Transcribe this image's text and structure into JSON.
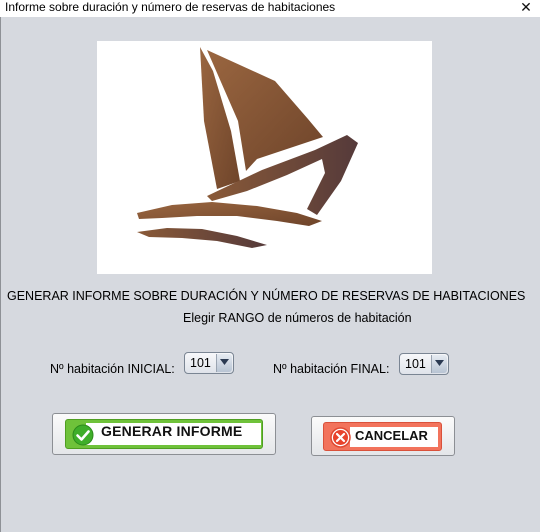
{
  "window": {
    "title": "Informe sobre duración y número de reservas de habitaciones",
    "close_glyph": "✕"
  },
  "main": {
    "heading": "GENERAR INFORME SOBRE DURACIÓN Y NÚMERO DE RESERVAS DE HABITACIONES",
    "subheading": "Elegir RANGO de números de habitación",
    "initial_label": "Nº habitación INICIAL:",
    "initial_value": "101",
    "final_label": "Nº habitación FINAL:",
    "final_value": "101"
  },
  "buttons": {
    "generate_label": "GENERAR INFORME",
    "generate_icon": "check-circle-icon",
    "cancel_label": "CANCELAR",
    "cancel_icon": "x-circle-icon"
  },
  "colors": {
    "logo_brown": "#8a5a38",
    "generate_green": "#6fc23a",
    "cancel_red": "#f2735c"
  }
}
